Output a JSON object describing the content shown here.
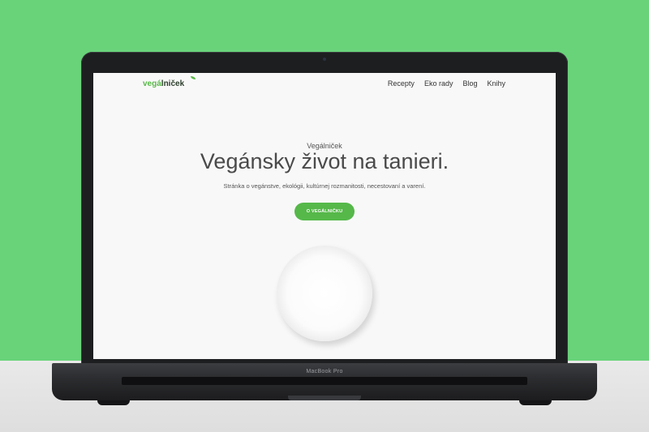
{
  "site": {
    "logo_part1": "vegá",
    "logo_part2": "lniček",
    "nav": [
      "Recepty",
      "Eko rady",
      "Blog",
      "Knihy"
    ]
  },
  "hero": {
    "eyebrow": "Vegálniček",
    "title": "Vegánsky život na tanieri.",
    "subtitle": "Stránka o vegánstve, ekológii, kultúrnej rozmanitosti, necestovaní a varení.",
    "cta_label": "O VEGÁLNIČKU"
  },
  "device": {
    "model": "MacBook Pro"
  },
  "colors": {
    "background": "#69d37a",
    "brand_green": "#55b849"
  }
}
